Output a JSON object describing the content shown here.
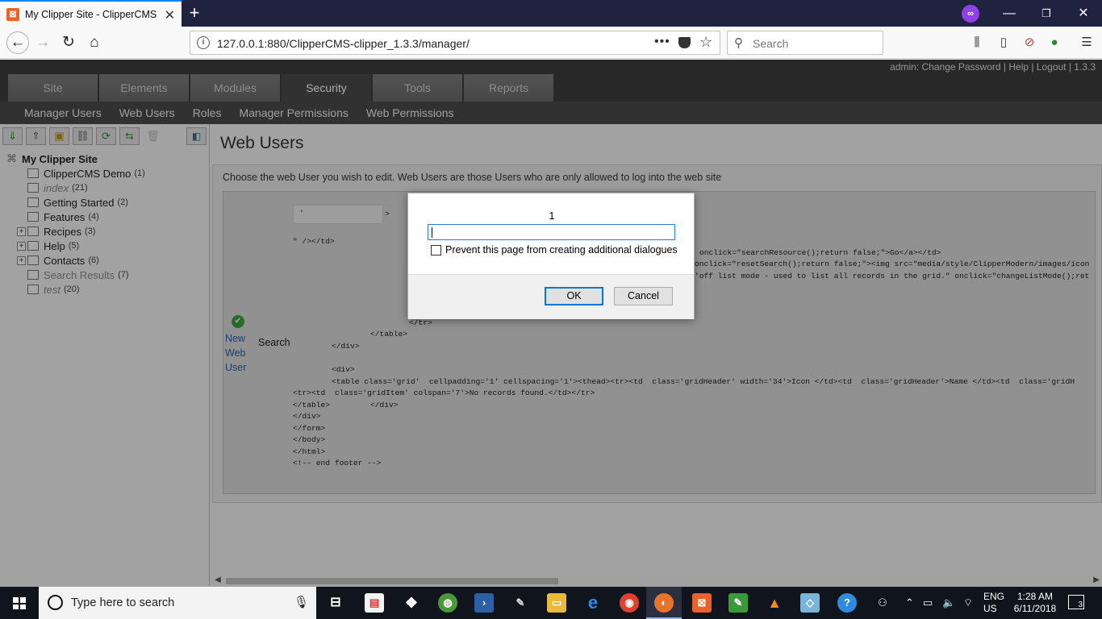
{
  "browser": {
    "tab_title": "My Clipper Site - ClipperCMS n",
    "tab_favicon": "clipper-icon",
    "url": "127.0.0.1:880/ClipperCMS-clipper_1.3.3/manager/",
    "search_placeholder": "Search",
    "new_tab_glyph": "+",
    "menu_badge_count": "!",
    "accent_color": "#0a84ff",
    "chrome_dark": "#202340"
  },
  "cms": {
    "user_links": "admin: Change Password | Help | Logout | 1.3.3",
    "main_tabs": [
      "Site",
      "Elements",
      "Modules",
      "Security",
      "Tools",
      "Reports"
    ],
    "active_tab": "Security",
    "sub_nav": [
      "Manager Users",
      "Web Users",
      "Roles",
      "Manager Permissions",
      "Web Permissions"
    ]
  },
  "tree": {
    "root": "My Clipper Site",
    "nodes": [
      {
        "label": "ClipperCMS Demo",
        "count": "(1)",
        "expandable": false,
        "published": true
      },
      {
        "label": "index",
        "count": "(21)",
        "expandable": false,
        "published": false
      },
      {
        "label": "Getting Started",
        "count": "(2)",
        "expandable": false,
        "published": true
      },
      {
        "label": "Features",
        "count": "(4)",
        "expandable": false,
        "published": true
      },
      {
        "label": "Recipes",
        "count": "(3)",
        "expandable": true,
        "published": true
      },
      {
        "label": "Help",
        "count": "(5)",
        "expandable": true,
        "published": true
      },
      {
        "label": "Contacts",
        "count": "(6)",
        "expandable": true,
        "published": true
      },
      {
        "label": "Search Results",
        "count": "(7)",
        "expandable": false,
        "published": false
      },
      {
        "label": "test",
        "count": "(20)",
        "expandable": false,
        "published": false
      }
    ]
  },
  "page": {
    "title": "Web Users",
    "intro": "Choose the web User you wish to edit. Web Users are those Users who are only allowed to log into the web site",
    "new_user_lines": [
      "New",
      "Web",
      "User"
    ],
    "search_label": "Search",
    "code_lines": {
      "l1": "'",
      "l1b": ">",
      "l2": "\" /></td>",
      "l3": "onclick=\"searchResource();return false;\">Go</a></td>",
      "l4": "onclick=\"resetSearch();return false;\"><img src=\"media/style/ClipperModern/images/icon",
      "l5": "'off list mode - used to list all records in the grid.\" onclick=\"changeListMode();ret",
      "l6": "</tr>",
      "l7": "</table>",
      "l8": "</div>",
      "l9": "<div>",
      "l10": "<table class='grid'  cellpadding='1' cellspacing='1'><thead><tr><td  class='gridHeader' width='34'>Icon </td><td  class='gridHeader'>Name </td><td  class='gridH",
      "l11": "<tr><td  class='gridItem' colspan='7'>No records found.</td></tr>",
      "l12": "</table>",
      "l12b": "</div>",
      "l13": "</div>",
      "l14": "</form>",
      "l15": "</body>",
      "l16": "</html>",
      "l17": "<!-- end footer -->"
    }
  },
  "dialog": {
    "message": "1",
    "input_value": "",
    "checkbox_label": "Prevent this page from creating additional dialogues",
    "ok_label": "OK",
    "cancel_label": "Cancel"
  },
  "taskbar": {
    "search_placeholder": "Type here to search",
    "lang_line1": "ENG",
    "lang_line2": "US",
    "time": "1:28 AM",
    "date": "6/11/2018",
    "notification_count": "3"
  }
}
